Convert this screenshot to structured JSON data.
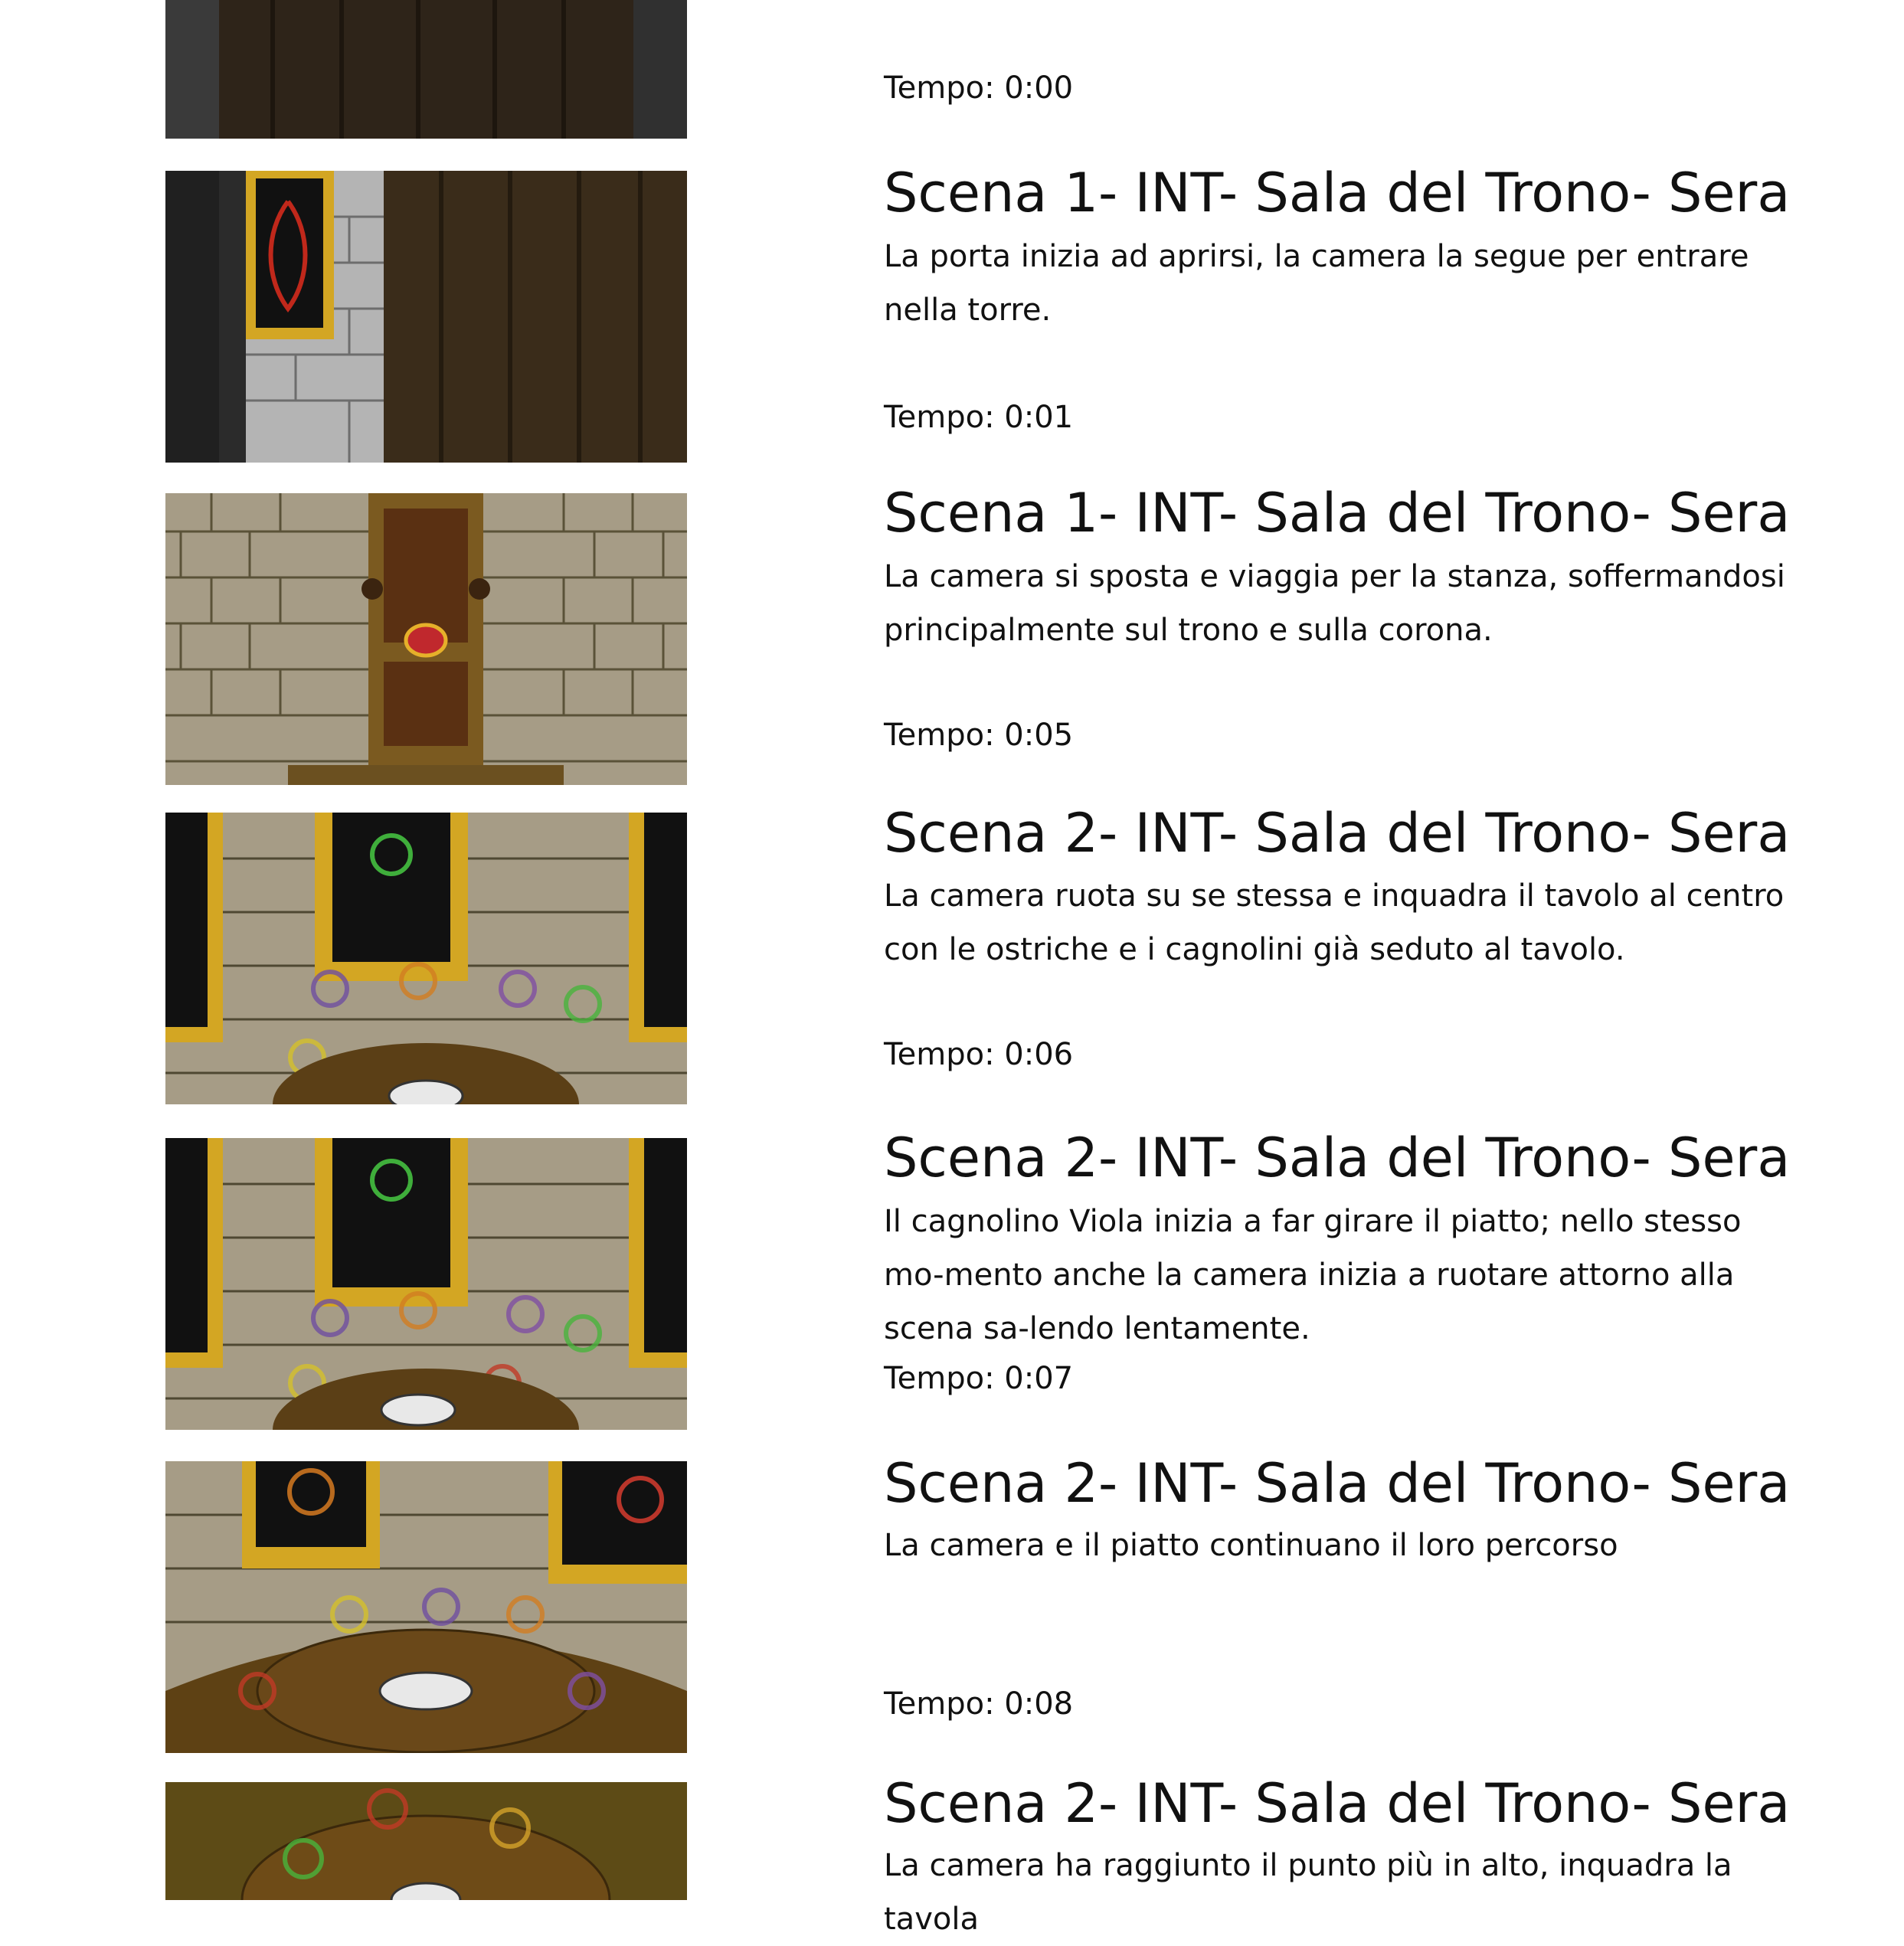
{
  "panels": [
    {
      "heading": "",
      "description": "",
      "tempo": "Tempo: 0:00",
      "shot": "door-closed"
    },
    {
      "heading": "Scena 1- INT- Sala del Trono- Sera",
      "description": "La porta inizia ad aprirsi, la camera la segue per entrare nella torre.",
      "tempo": "Tempo: 0:01",
      "shot": "door-opening"
    },
    {
      "heading": "Scena 1- INT- Sala del Trono- Sera",
      "description": "La camera si sposta e viaggia per la stanza, soffermandosi principalmente sul trono e sulla corona.",
      "tempo": "Tempo: 0:05",
      "shot": "throne-crown"
    },
    {
      "heading": "Scena 2- INT- Sala del Trono- Sera",
      "description": "La camera ruota su se stessa e inquadra il tavolo al centro con le ostriche e i cagnolini già seduto al tavolo.",
      "tempo": "Tempo: 0:06",
      "shot": "table-dogs"
    },
    {
      "heading": "Scena 2- INT- Sala del Trono- Sera",
      "description": "Il cagnolino Viola inizia a far girare il piatto; nello stesso mo-mento anche la camera inizia a ruotare attorno alla scena sa-lendo lentamente.",
      "tempo": "Tempo: 0:07",
      "shot": "table-dogs-spin"
    },
    {
      "heading": "Scena 2- INT- Sala del Trono- Sera",
      "description": "La camera e il piatto continuano il loro percorso",
      "tempo": "Tempo: 0:08",
      "shot": "table-rising"
    },
    {
      "heading": "Scena 2- INT- Sala del Trono- Sera",
      "description": "La camera ha raggiunto il punto più in alto, inquadra la tavola",
      "tempo": "",
      "shot": "table-top-view"
    }
  ]
}
